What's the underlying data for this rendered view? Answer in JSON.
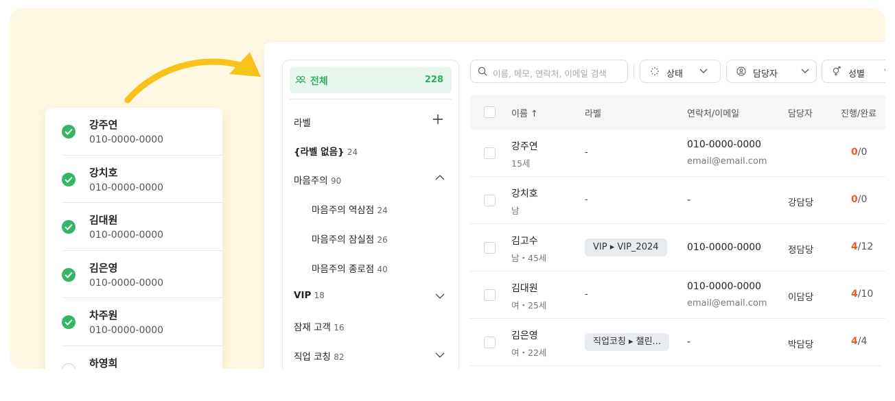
{
  "contacts": [
    {
      "name": "강주연",
      "phone": "010-0000-0000",
      "checked": true
    },
    {
      "name": "강치호",
      "phone": "010-0000-0000",
      "checked": true
    },
    {
      "name": "김대원",
      "phone": "010-0000-0000",
      "checked": true
    },
    {
      "name": "김은영",
      "phone": "010-0000-0000",
      "checked": true
    },
    {
      "name": "차주원",
      "phone": "010-0000-0000",
      "checked": true
    },
    {
      "name": "하영희",
      "phone": "",
      "checked": false
    }
  ],
  "sidebar": {
    "all_label": "전체",
    "all_count": "228",
    "label_header": "라벨",
    "items": [
      {
        "label": "{라벨 없음}",
        "count": "24"
      },
      {
        "label": "마음주의",
        "count": "90"
      },
      {
        "label": "마음주의 역삼점",
        "count": "24"
      },
      {
        "label": "마음주의 잠실점",
        "count": "26"
      },
      {
        "label": "마음주의 종로점",
        "count": "40"
      },
      {
        "label": "VIP",
        "count": "18"
      },
      {
        "label": "잠재 고객",
        "count": "16"
      },
      {
        "label": "직업 코칭",
        "count": "82"
      }
    ]
  },
  "toolbar": {
    "search_placeholder": "이름, 메모, 연락처, 이메일 검색",
    "filter_status": "상태",
    "filter_manager": "담당자",
    "filter_gender": "성별"
  },
  "table": {
    "headers": {
      "name": "이름 ↑",
      "label": "라벨",
      "contact": "연락처/이메일",
      "manager": "담당자",
      "progress": "진행/완료"
    },
    "rows": [
      {
        "name": "강주연",
        "meta": "15세",
        "label": "-",
        "phone": "010-0000-0000",
        "email": "email@email.com",
        "manager": "",
        "done": "0",
        "total": "/0"
      },
      {
        "name": "강치호",
        "meta": "남",
        "label": "-",
        "phone": "-",
        "email": "",
        "manager": "강담당",
        "done": "0",
        "total": "/0"
      },
      {
        "name": "김고수",
        "meta": "남・45세",
        "label": "VIP ▸ VIP_2024",
        "phone": "010-0000-0000",
        "email": "",
        "manager": "정담당",
        "done": "4",
        "total": "/12"
      },
      {
        "name": "김대원",
        "meta": "여・25세",
        "label": "-",
        "phone": "010-0000-0000",
        "email": "email@email.com",
        "manager": "이담당",
        "done": "4",
        "total": "/10"
      },
      {
        "name": "김은영",
        "meta": "여・22세",
        "label": "직업코칭 ▸ 챌린...",
        "phone": "-",
        "email": "",
        "manager": "박담당",
        "done": "4",
        "total": "/4"
      }
    ]
  },
  "colors": {
    "accent_green": "#34b567",
    "arrow_yellow": "#f7c21a",
    "progress_orange": "#ef5b25"
  }
}
